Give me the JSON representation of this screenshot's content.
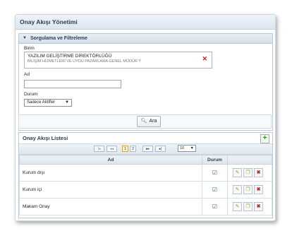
{
  "window": {
    "title": "Onay Akışı Yönetimi"
  },
  "filter": {
    "title": "Sorgulama ve Filtreleme",
    "birim_label": "Birim",
    "birim_line1": "YAZILIM GELİŞTİRME DİREKTÖRLÜĞÜ",
    "birim_line2": "BİLİŞİM HİZMETLERİ VE UYDU PAZARLAMA GENEL MÜDÜR Y",
    "ad_label": "Ad",
    "ad_value": "",
    "durum_label": "Durum",
    "durum_value": "Sadece Aktifler",
    "search_button": "Ara"
  },
  "list": {
    "title": "Onay Akışı Listesi",
    "pager": {
      "pages": [
        "1",
        "2"
      ],
      "current": "1",
      "page_size": "10"
    },
    "columns": {
      "name": "Ad",
      "status": "Durum"
    },
    "rows": [
      {
        "name": "Kurum dışı"
      },
      {
        "name": "Kurum içi"
      },
      {
        "name": "Makam Onay"
      }
    ]
  },
  "colors": {
    "accent": "#d5e0ea",
    "add": "#1c9a1c",
    "delete": "#c0242a"
  }
}
